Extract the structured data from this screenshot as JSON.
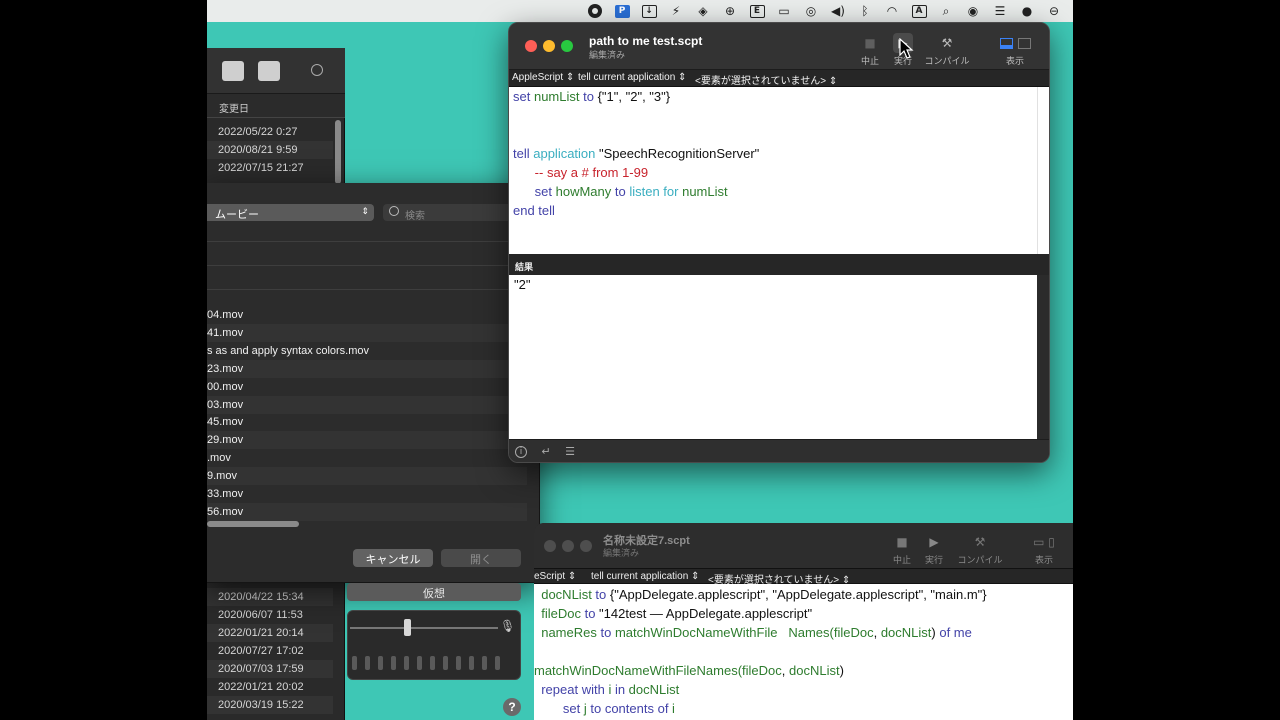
{
  "menubar": {
    "icons": [
      "record-icon",
      "p-app-icon",
      "download-icon",
      "bolt-icon",
      "layers-icon",
      "globe-icon",
      "letter-icon",
      "display-icon",
      "airdrop-icon",
      "volume-icon",
      "bluetooth-icon",
      "wifi-icon",
      "input-source-icon",
      "search-icon",
      "user-icon",
      "control-center-icon",
      "siri-icon",
      "menu-extra-icon"
    ],
    "input_source_label": "A"
  },
  "finder": {
    "header_label": "変更日",
    "dates_top": [
      "2022/05/22 0:27",
      "2020/08/21 9:59",
      "2022/07/15 21:27"
    ],
    "dates_bottom": [
      "2020/04/22 15:34",
      "2020/06/07 11:53",
      "2022/01/21 20:14",
      "2020/07/27 17:02",
      "2020/07/03 17:59",
      "2022/01/21 20:02",
      "2020/03/19 15:22"
    ]
  },
  "dialog": {
    "location": "ムービー",
    "search_placeholder": "検索",
    "files": [
      "04.mov",
      "41.mov",
      "s as and apply syntax colors.mov",
      "23.mov",
      "00.mov",
      "03.mov",
      "45.mov",
      "29.mov",
      ".mov",
      "9.mov",
      "33.mov",
      "56.mov"
    ],
    "cancel_label": "キャンセル",
    "open_label": "開く"
  },
  "dictation": {
    "label": "仮想"
  },
  "win1": {
    "title": "path to me test.scpt",
    "status": "編集済み",
    "toolbar": {
      "stop": "中止",
      "run": "実行",
      "compile": "コンパイル",
      "view": "表示"
    },
    "nav": {
      "language": "AppleScript",
      "target": "tell current application",
      "element": "<要素が選択されていません>"
    },
    "code": [
      [
        {
          "t": "set ",
          "c": "kw"
        },
        {
          "t": "numList",
          "c": "var"
        },
        {
          "t": " to ",
          "c": "kw"
        },
        {
          "t": "{\"1\", \"2\", \"3\"}",
          "c": "str"
        }
      ],
      [],
      [],
      [
        {
          "t": "tell ",
          "c": "kw"
        },
        {
          "t": "application",
          "c": "app"
        },
        {
          "t": " \"SpeechRecognitionServer\"",
          "c": "str"
        }
      ],
      [
        {
          "t": "      -- say a # from 1-99",
          "c": "cmt"
        }
      ],
      [
        {
          "t": "      set ",
          "c": "kw"
        },
        {
          "t": "howMany",
          "c": "var"
        },
        {
          "t": " to ",
          "c": "kw"
        },
        {
          "t": "listen for",
          "c": "app"
        },
        {
          "t": " numList",
          "c": "var"
        }
      ],
      [
        {
          "t": "end tell",
          "c": "kw"
        }
      ]
    ],
    "result_label": "結果",
    "result_value": "\"2\""
  },
  "win2": {
    "title": "名称未設定7.scpt",
    "status": "編集済み",
    "toolbar": {
      "stop": "中止",
      "run": "実行",
      "compile": "コンパイル",
      "view": "表示"
    },
    "nav": {
      "language": "eScript",
      "target": "tell current application",
      "element": "<要素が選択されていません>"
    },
    "code": [
      [
        {
          "t": "  docNList",
          "c": "var"
        },
        {
          "t": " to ",
          "c": "kw"
        },
        {
          "t": "{\"AppDelegate.applescript\", \"AppDelegate.applescript\", \"main.m\"}",
          "c": "str"
        }
      ],
      [
        {
          "t": "  fileDoc",
          "c": "var"
        },
        {
          "t": " to ",
          "c": "kw"
        },
        {
          "t": "\"142test — AppDelegate.applescript\"",
          "c": "str"
        }
      ],
      [
        {
          "t": "  nameRes",
          "c": "var"
        },
        {
          "t": " to ",
          "c": "kw"
        },
        {
          "t": "matchWinDocNameWithFile   Names(",
          "c": "var"
        },
        {
          "t": "fileDoc",
          "c": "var"
        },
        {
          "t": ", ",
          "c": "str"
        },
        {
          "t": "docNList",
          "c": "var"
        },
        {
          "t": ") ",
          "c": "str"
        },
        {
          "t": "of me",
          "c": "kw"
        }
      ],
      [],
      [
        {
          "t": "matchWinDocNameWithFileNames(",
          "c": "var"
        },
        {
          "t": "fileDoc",
          "c": "var"
        },
        {
          "t": ", ",
          "c": "str"
        },
        {
          "t": "docNList",
          "c": "var"
        },
        {
          "t": ")",
          "c": "str"
        }
      ],
      [
        {
          "t": "  repeat with ",
          "c": "kw"
        },
        {
          "t": "i",
          "c": "var"
        },
        {
          "t": " in ",
          "c": "kw"
        },
        {
          "t": "docNList",
          "c": "var"
        }
      ],
      [
        {
          "t": "        set ",
          "c": "kw"
        },
        {
          "t": "j",
          "c": "var"
        },
        {
          "t": " to ",
          "c": "kw"
        },
        {
          "t": "contents of ",
          "c": "kw"
        },
        {
          "t": "i",
          "c": "var"
        }
      ]
    ]
  }
}
